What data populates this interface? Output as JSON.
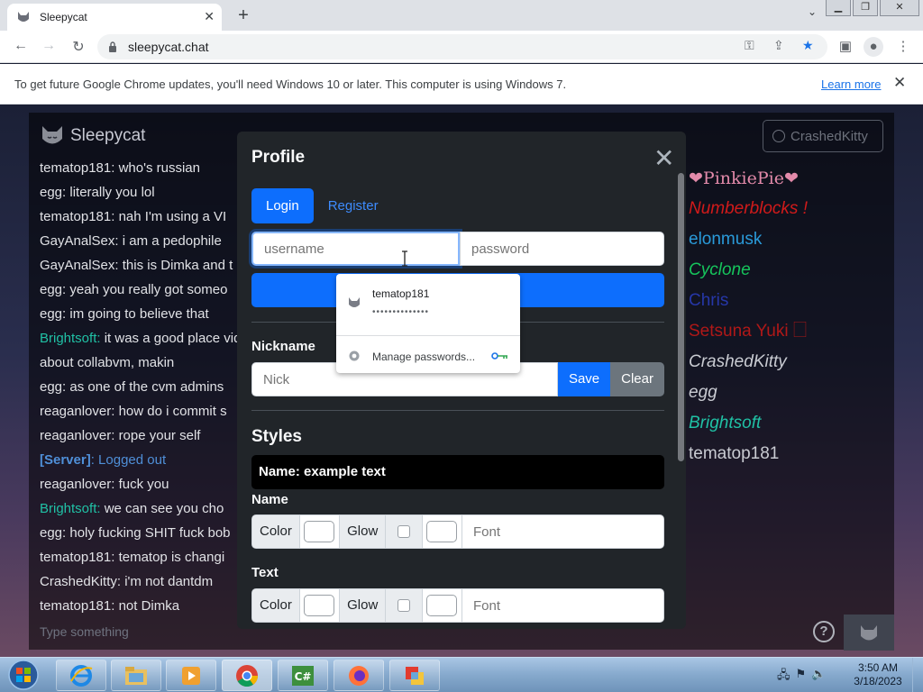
{
  "browser": {
    "tab_title": "Sleepycat",
    "new_tab": "+",
    "url": "sleepycat.chat",
    "infobar_message": "To get future Google Chrome updates, you'll need Windows 10 or later. This computer is using Windows 7.",
    "infobar_link": "Learn more"
  },
  "app": {
    "brand": "Sleepycat",
    "current_user": "CrashedKitty",
    "chat_placeholder": "Type something",
    "help_label": "?"
  },
  "chat": [
    {
      "user": "tematop181",
      "sep": ": ",
      "text": "who's russian",
      "style": "normal"
    },
    {
      "user": "egg",
      "sep": ": ",
      "text": "literally you lol",
      "style": "normal"
    },
    {
      "user": "tematop181",
      "sep": ": ",
      "text": "nah I'm using a VI",
      "style": "normal"
    },
    {
      "user": "GayAnalSex",
      "sep": ": ",
      "text": "i am a pedophile",
      "style": "normal"
    },
    {
      "user": "GayAnalSex",
      "sep": ": ",
      "text": "this is Dimka and t",
      "style": "normal"
    },
    {
      "user": "egg",
      "sep": ": ",
      "text": "yeah you really got someo",
      "style": "normal"
    },
    {
      "user": "egg",
      "sep": ": ",
      "text": "im going to believe that",
      "style": "normal"
    },
    {
      "user": "Brightsoft",
      "sep": ": ",
      "text": "it was a good place video about collabvm, makin",
      "style": "teal"
    },
    {
      "user": "egg",
      "sep": ": ",
      "text": "as one of the cvm admins",
      "style": "normal"
    },
    {
      "user": "reaganlover",
      "sep": ": ",
      "text": "how do i commit s",
      "style": "normal"
    },
    {
      "user": "reaganlover",
      "sep": ": ",
      "text": "rope your self",
      "style": "normal"
    },
    {
      "user": "[Server]",
      "sep": ": ",
      "text": "Logged out",
      "style": "server"
    },
    {
      "user": "reaganlover",
      "sep": ": ",
      "text": "fuck you",
      "style": "normal"
    },
    {
      "user": "Brightsoft",
      "sep": ": ",
      "text": "we can see you cho",
      "style": "teal"
    },
    {
      "user": "egg",
      "sep": ": ",
      "text": "holy fucking SHIT fuck bob",
      "style": "normal"
    },
    {
      "user": "tematop181",
      "sep": ": ",
      "text": "tematop is changi",
      "style": "normal"
    },
    {
      "user": "CrashedKitty",
      "sep": ": ",
      "text": "i'm not dantdm",
      "style": "normal"
    },
    {
      "user": "tematop181",
      "sep": ": ",
      "text": "not Dimka",
      "style": "normal"
    }
  ],
  "users": [
    {
      "name": "❤PinkiePie❤",
      "color": "#e38aaa",
      "font": "\"DejaVu Serif\", serif",
      "italic": false
    },
    {
      "name": "Numberblocks !",
      "color": "#d11a1a",
      "font": "\"Liberation Sans\", sans-serif",
      "italic": true
    },
    {
      "name": "elonmusk",
      "color": "#2a9ad9",
      "font": "\"Liberation Sans\", sans-serif",
      "italic": false
    },
    {
      "name": "Cyclone",
      "color": "#16c45c",
      "font": "\"Liberation Sans\", sans-serif",
      "italic": true
    },
    {
      "name": "Chris",
      "color": "#2637a8",
      "font": "\"Liberation Sans\", sans-serif",
      "italic": false
    },
    {
      "name": "Setsuna Yuki 🗌",
      "color": "#b01818",
      "font": "\"Liberation Sans\", sans-serif",
      "italic": false
    },
    {
      "name": "CrashedKitty",
      "color": "#c9cbd2",
      "font": "\"Liberation Sans\", sans-serif",
      "italic": true
    },
    {
      "name": "egg",
      "color": "#c9cbd2",
      "font": "\"Liberation Sans\", sans-serif",
      "italic": true
    },
    {
      "name": "Brightsoft",
      "color": "#20c1a5",
      "font": "\"Liberation Sans\", sans-serif",
      "italic": true
    },
    {
      "name": "tematop181",
      "color": "#c9cbd2",
      "font": "\"Liberation Sans\", sans-serif",
      "italic": false
    }
  ],
  "modal": {
    "title": "Profile",
    "close": "✕",
    "tab_login": "Login",
    "tab_register": "Register",
    "username_placeholder": "username",
    "password_placeholder": "password",
    "nickname_label": "Nickname",
    "nick_placeholder": "Nick",
    "save_label": "Save",
    "clear_label": "Clear",
    "styles_heading": "Styles",
    "preview_text": "Name:  example text",
    "name_section": "Name",
    "text_section": "Text",
    "color_label": "Color",
    "glow_label": "Glow",
    "font_placeholder": "Font"
  },
  "password_dropdown": {
    "username": "tematop181",
    "password_mask": "••••••••••••••",
    "manage": "Manage passwords..."
  },
  "taskbar": {
    "time": "3:50 AM",
    "date": "3/18/2023"
  },
  "colors": {
    "accent": "#0d6efd",
    "modal_bg": "#212529",
    "chrome_frame": "#dee1e6"
  }
}
